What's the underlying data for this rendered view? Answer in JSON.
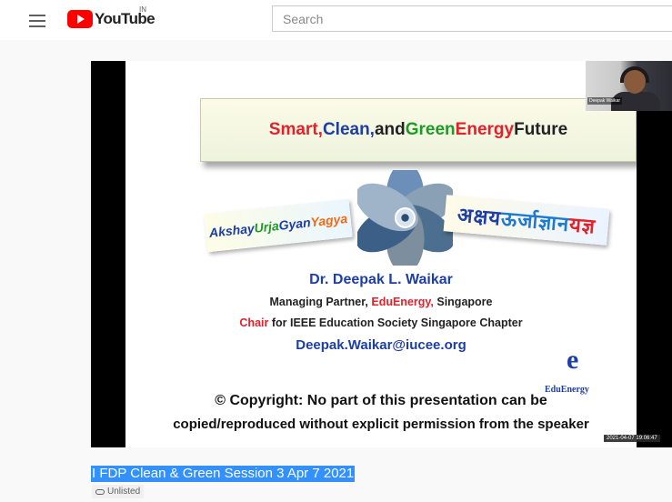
{
  "header": {
    "menu_icon": "hamburger-icon",
    "logo_text": "YouTube",
    "logo_region": "IN",
    "search_placeholder": "Search"
  },
  "video": {
    "slide": {
      "title_parts": [
        "Smart, ",
        "Clean, ",
        "and ",
        "Green ",
        "Energy ",
        "Future"
      ],
      "banner_left_parts": [
        "Akshay ",
        "Urja ",
        "Gyan ",
        "Yagya"
      ],
      "banner_right_parts": [
        "अक्षय ",
        "ऊर्जा ",
        "ज्ञान ",
        "यज्ञ"
      ],
      "presenter_name": "Dr. Deepak L. Waikar",
      "role_prefix": "Managing Partner, ",
      "role_org": "EduEnergy,",
      "role_suffix": " Singapore",
      "chair_prefix": "Chair",
      "chair_suffix": " for IEEE Education Society Singapore Chapter",
      "email": "Deepak.Waikar@iucee.org",
      "brand_letter": "e",
      "brand_name": "EduEnergy",
      "copyright_line1": "© Copyright: No part of this presentation can be",
      "copyright_line2": "copied/reproduced without explicit permission from the speaker"
    },
    "webcam_name": "Deepak Waikar",
    "timestamp": "2021-04-07 19:06:47",
    "title": "I FDP Clean & Green Session 3 Apr 7 2021",
    "visibility_icon": "link-icon",
    "visibility": "Unlisted"
  },
  "colors": {
    "youtube_red": "#ff0000",
    "selection_blue": "#3390ff",
    "slide_red": "#e3212b",
    "slide_blue": "#1d3ea7",
    "slide_green": "#1e9a27",
    "slide_orange": "#f46a15"
  }
}
